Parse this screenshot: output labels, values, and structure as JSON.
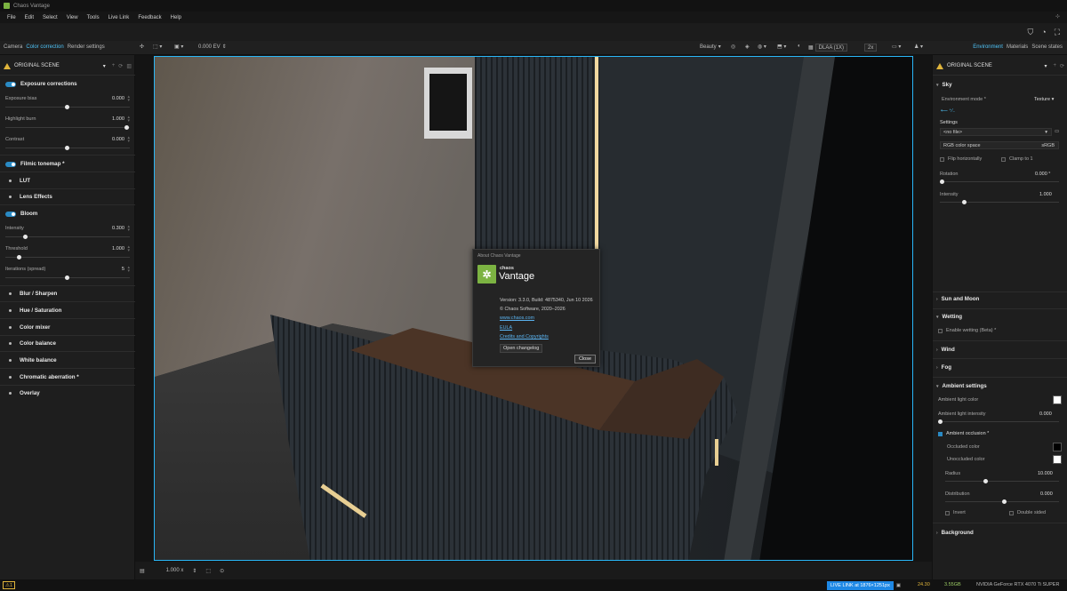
{
  "window": {
    "title": "Chaos Vantage"
  },
  "menu": [
    "File",
    "Edit",
    "Select",
    "View",
    "Tools",
    "Live Link",
    "Feedback",
    "Help"
  ],
  "left_tabs": [
    "Camera",
    "Color correction",
    "Render settings"
  ],
  "left_active_tab": "Color correction",
  "right_tabs": [
    "Environment",
    "Materials",
    "Scene states"
  ],
  "right_active_tab": "Environment",
  "viewport_toolbar": {
    "ev": "0.000 EV",
    "pass": "Beauty",
    "aa": "DLAA (1X)",
    "scale": "2x"
  },
  "left_panel": {
    "scene": "ORIGINAL SCENE",
    "exposure": {
      "title": "Exposure corrections",
      "params": [
        {
          "label": "Exposure bias",
          "value": "0.000",
          "pos": 0.5
        },
        {
          "label": "Highlight burn",
          "value": "1.000",
          "pos": 1.0
        },
        {
          "label": "Contrast",
          "value": "0.000",
          "pos": 0.5
        }
      ]
    },
    "filmic": "Filmic tonemap *",
    "lut": "LUT",
    "lens": "Lens Effects",
    "bloom": {
      "title": "Bloom",
      "params": [
        {
          "label": "Intensity",
          "value": "0.300",
          "pos": 0.15
        },
        {
          "label": "Threshold",
          "value": "1.000",
          "pos": 0.1
        },
        {
          "label": "Iterations (spread)",
          "value": "5",
          "pos": 0.5
        }
      ]
    },
    "sections": [
      "Blur / Sharpen",
      "Hue / Saturation",
      "Color mixer",
      "Color balance",
      "White balance",
      "Chromatic aberration *",
      "Overlay"
    ]
  },
  "right_panel": {
    "scene": "ORIGINAL SCENE",
    "sky": {
      "title": "Sky",
      "env_mode_label": "Environment mode *",
      "env_mode_value": "Texture",
      "settings_label": "Settings",
      "file": "<no file>",
      "rgb_label": "RGB color space",
      "rgb_value": "sRGB",
      "flip": "Flip horizontally",
      "clamp": "Clamp to 1",
      "rotation_label": "Rotation",
      "rotation_value": "0.000 °",
      "intensity_label": "Intensity",
      "intensity_value": "1.000"
    },
    "sun": "Sun and Moon",
    "wetting": {
      "title": "Wetting",
      "enable": "Enable wetting (Beta) *"
    },
    "wind": "Wind",
    "fog": "Fog",
    "ambient": {
      "title": "Ambient settings",
      "light_color": "Ambient light color",
      "light_intensity_label": "Ambient light intensity",
      "light_intensity_value": "0.000",
      "ao": "Ambient occlusion *",
      "occluded": "Occluded color",
      "unoccluded": "Unoccluded color",
      "radius_label": "Radius",
      "radius_value": "10.000",
      "distribution_label": "Distribution",
      "distribution_value": "0.000",
      "invert": "Invert",
      "double_sided": "Double sided"
    },
    "background": "Background"
  },
  "viewport_bottom": {
    "zoom": "1.000 x"
  },
  "about_dialog": {
    "title": "About Chaos Vantage",
    "brand_small": "chaos",
    "brand_big": "Vantage",
    "version": "Version: 3.3.0, Build: 4875340, Jun 10 2026",
    "copyright": "© Chaos Software, 2020–2026",
    "website": "www.chaos.com",
    "eula": "EULA",
    "credits": "Credits and Copyrights",
    "changelog": "Open changelog",
    "close": "Close"
  },
  "status": {
    "warn_count": "1",
    "live_link": "LIVE LINK at 1876×1251px",
    "fps": "24.30",
    "mem": "3.55GB",
    "gpu": "NVIDIA GeForce RTX 4070 Ti SUPER"
  },
  "colors": {
    "accent": "#29b6f6",
    "brand": "#7cb342"
  }
}
